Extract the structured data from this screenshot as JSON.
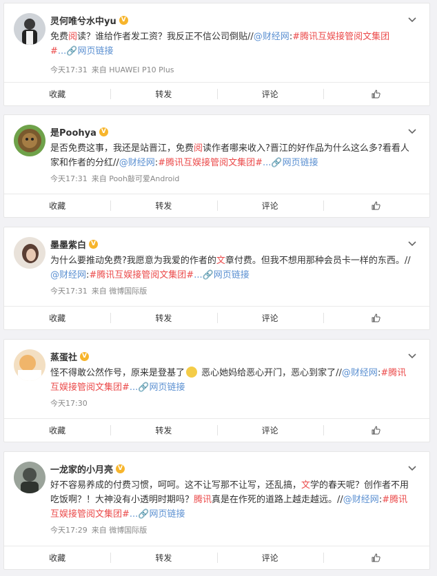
{
  "posts": [
    {
      "name": "灵何唯兮水中yu",
      "text_a": "免费",
      "text_hl": "阅",
      "text_b": "读？谁给作者发工资？我反正不信公司倒贴//",
      "mention": "@财经网",
      "sep": ":",
      "topic": "#腾讯互娱接管阅文集团#",
      "more": "...",
      "link": "网页链接",
      "time": "今天17:31",
      "source": "来自 HUAWEI P10 Plus"
    },
    {
      "name": "是Poohya",
      "text_a": "是否免费这事，我还是站晋江，免费",
      "text_hl": "阅",
      "text_b": "读作者哪来收入?晋江的好作品为什么这么多?看看人家和作者的分红//",
      "mention": "@财经网",
      "sep": ":",
      "topic": "#腾讯互娱接管阅文集团#",
      "more": "...",
      "link": "网页链接",
      "time": "今天17:31",
      "source": "来自 Pooh敲可爱Android"
    },
    {
      "name": "墨墨紫白",
      "text_a": "为什么要推动免费?我愿意为我爱的作者的",
      "text_hl": "文",
      "text_b": "章付费。但我不想用那种会员卡一样的东西。//",
      "mention": "@财经网",
      "sep": ":",
      "topic": "#腾讯互娱接管阅文集团#",
      "more": "...",
      "link": "网页链接",
      "time": "今天17:31",
      "source": "来自 微博国际版"
    },
    {
      "name": "蒸蛋社",
      "text_a": "怪不得敢公然作号，原来是登基了",
      "text_hl": "",
      "text_b": " 恶心她妈给恶心开门，恶心到家了//",
      "mention": "@财经网",
      "sep": ":",
      "topic": "#腾讯互娱接管阅文集团#",
      "more": "...",
      "link": "网页链接",
      "time": "今天17:30",
      "source": ""
    },
    {
      "name": "一龙家的小月亮",
      "text_a": "好不容易养成的付费习惯，呵呵。这不让写那不让写，还乱搞，",
      "text_hl": "文",
      "text_b": "学的春天呢？创作者不用吃饭啊？！大神没有小透明时期吗？",
      "text_hl2": "腾讯",
      "text_c": "真是在作死的道路上越走越远。//",
      "mention": "@财经网",
      "sep": ":",
      "topic": "#腾讯互娱接管阅文集团#",
      "more": "...",
      "link": "网页链接",
      "time": "今天17:29",
      "source": "来自 微博国际版"
    }
  ],
  "actions": {
    "collect": "收藏",
    "repost": "转发",
    "comment": "评论"
  }
}
